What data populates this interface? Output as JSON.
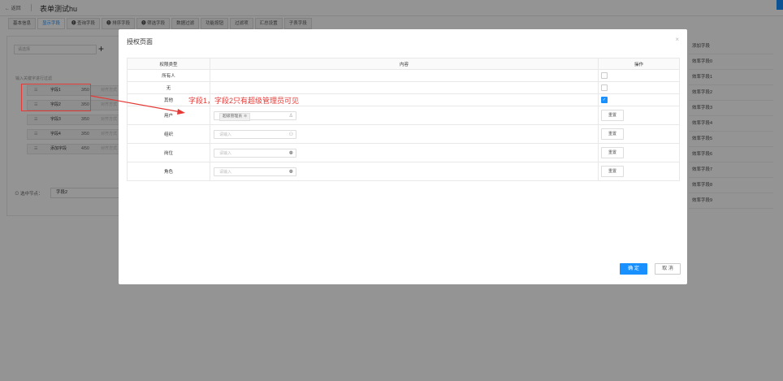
{
  "header": {
    "back_label": "← 返回",
    "title": "表单测试hu"
  },
  "tabs": [
    {
      "label": "基本信息"
    },
    {
      "label": "显示字段"
    },
    {
      "label": "❶ 查询字段"
    },
    {
      "label": "❶ 排序字段"
    },
    {
      "label": "❶ 筛选字段"
    },
    {
      "label": "数据过滤"
    },
    {
      "label": "功能按钮"
    },
    {
      "label": "过滤项"
    },
    {
      "label": "汇总设置"
    },
    {
      "label": "子表字段"
    }
  ],
  "left_panel": {
    "select_placeholder": "请选择",
    "keyword_placeholder": "输入关键字进行过滤",
    "fields": [
      {
        "name": "字段1",
        "count": "3/50",
        "dropdown": "对齐方式 ∨"
      },
      {
        "name": "字段2",
        "count": "3/50",
        "dropdown": "对齐方式 ∨"
      },
      {
        "name": "字段3",
        "count": "3/50",
        "dropdown": "对齐方式 ∨"
      },
      {
        "name": "字段4",
        "count": "3/50",
        "dropdown": "对齐方式 ∨"
      },
      {
        "name": "添加字段",
        "count": "4/50",
        "dropdown": "对齐方式 ∨"
      }
    ],
    "selected_node_label": "⊙ 选中节点：",
    "selected_node_value": "字段2"
  },
  "right_panel": {
    "items": [
      "添加字段",
      "效率字段0",
      "效率字段1",
      "效率字段2",
      "效率字段3",
      "效率字段4",
      "效率字段5",
      "效率字段6",
      "效率字段7",
      "效率字段8",
      "效率字段9"
    ]
  },
  "annotation": {
    "text": "字段1，字段2只有超级管理员可见",
    "color": "#e53935"
  },
  "modal": {
    "title": "授权页面",
    "close_glyph": "×",
    "columns": {
      "type": "权限类型",
      "content": "内容",
      "op": "操作"
    },
    "rows_checkbox": [
      {
        "type": "所有人",
        "checked": false
      },
      {
        "type": "无",
        "checked": false
      },
      {
        "type": "其他",
        "checked": true
      }
    ],
    "rows_input": [
      {
        "type": "用户",
        "tag": "超级管理员",
        "placeholder": "",
        "reset": "重置"
      },
      {
        "type": "组织",
        "placeholder": "请输入",
        "reset": "重置"
      },
      {
        "type": "岗位",
        "placeholder": "请输入",
        "reset": "重置"
      },
      {
        "type": "角色",
        "placeholder": "请输入",
        "reset": "重置"
      }
    ],
    "ok_label": "确 定",
    "cancel_label": "取 消"
  },
  "colors": {
    "accent": "#1890ff",
    "highlight": "#e53935"
  }
}
